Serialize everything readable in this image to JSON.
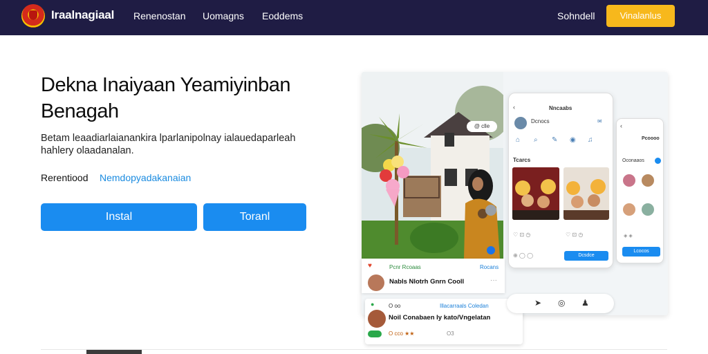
{
  "nav": {
    "brand": "Iraalnagiaal",
    "links": [
      "Renenostan",
      "Uomagns",
      "Eoddems"
    ],
    "signin": "Sohndell",
    "cta": "Vinalanlus"
  },
  "hero": {
    "headline": "Dekna Inaiyaan Yeamiyinban Benagah",
    "sub": "Betam leaadiarlaianankira lparlanipolnay ialauedaparleah hahlery olaadanalan.",
    "rec_label": "Rerentiood",
    "rec_link": "Nemdopyadakanaian",
    "btn_install": "Instal",
    "btn_secondary": "Toranl"
  },
  "mockup": {
    "photo_pill": "@ clle",
    "card1": {
      "label_left": "Pcnr Rcoaas",
      "label_right": "Rocans",
      "name": "Nabls Nlotrh Gnrn Cooll"
    },
    "card2": {
      "label_left": "O oo",
      "label_right": "Illacarraals Coledan",
      "title": "Noil Conabaen Iy kato/Vngelatan",
      "meta": "O cco ★★",
      "meta_right": "O3"
    },
    "phone1": {
      "title": "Nncaabs",
      "user": "Dcnocs",
      "section": "Tcarcs",
      "button": "Dcsdce"
    },
    "phone2": {
      "title": "Pcoooo",
      "section": "Oconaaos",
      "button": "Lcocos"
    }
  }
}
